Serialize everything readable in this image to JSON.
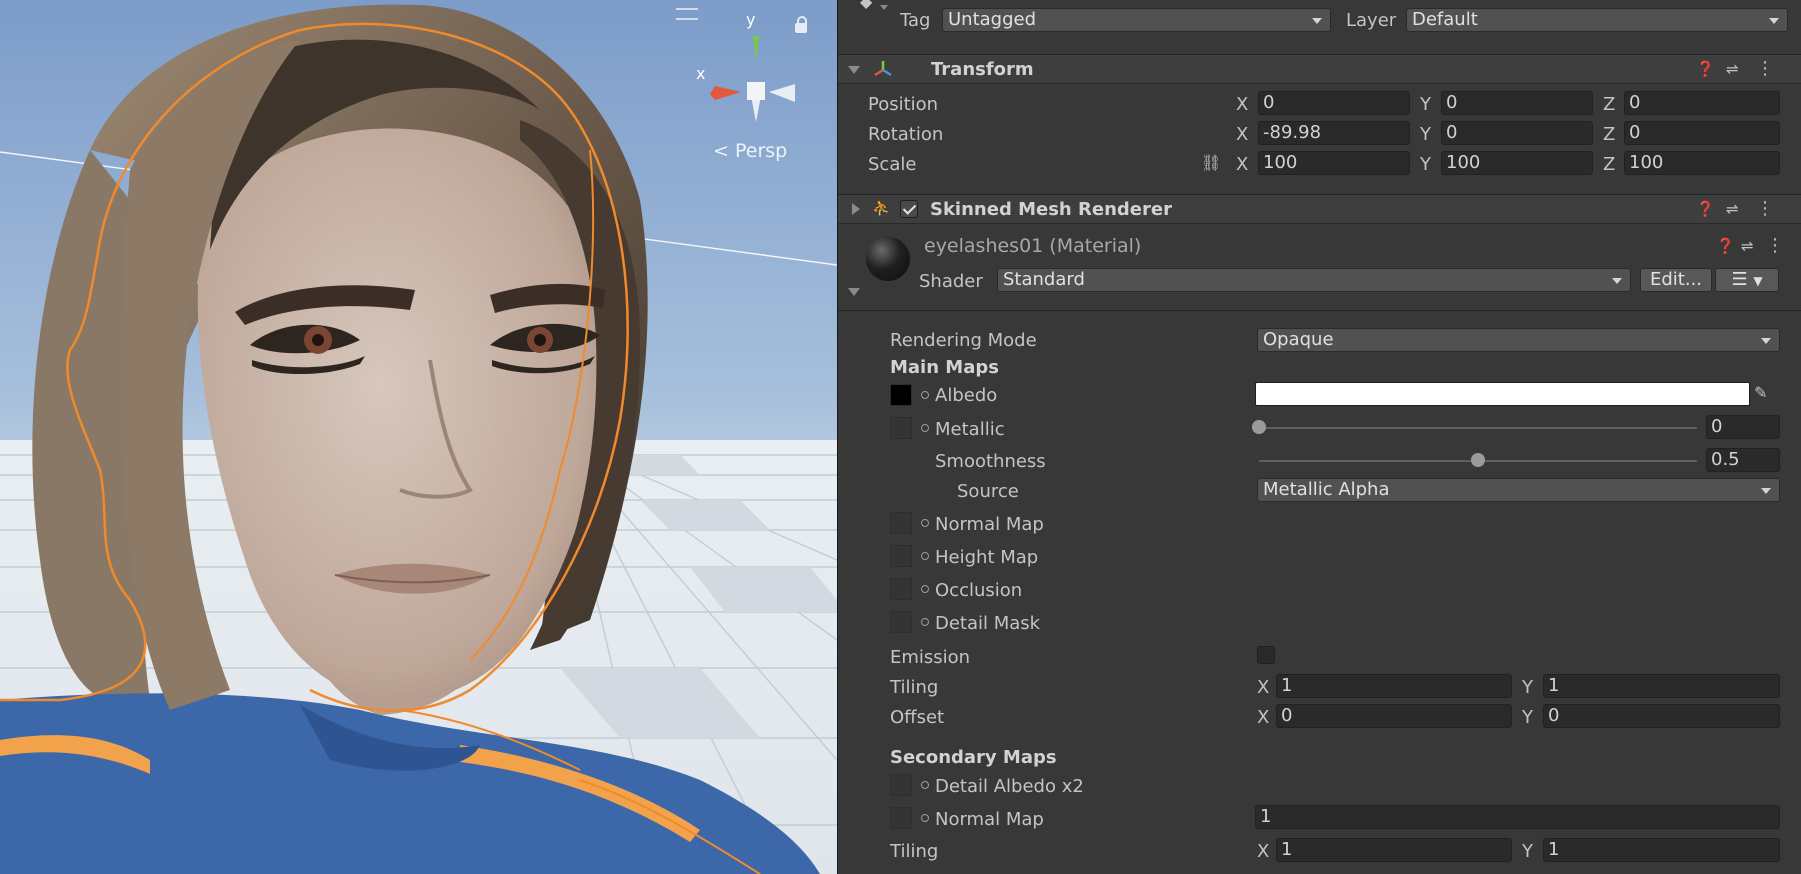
{
  "scene": {
    "gizmo_y_label": "y",
    "gizmo_x_label": "x",
    "projection_label": "Persp"
  },
  "inspector": {
    "tag_label": "Tag",
    "tag_value": "Untagged",
    "layer_label": "Layer",
    "layer_value": "Default",
    "transform": {
      "title": "Transform",
      "rows": [
        {
          "label": "Position",
          "x": "0",
          "y": "0",
          "z": "0"
        },
        {
          "label": "Rotation",
          "x": "-89.98",
          "y": "0",
          "z": "0"
        },
        {
          "label": "Scale",
          "x": "100",
          "y": "100",
          "z": "100"
        }
      ],
      "axis_x": "X",
      "axis_y": "Y",
      "axis_z": "Z"
    },
    "skinned_mesh": {
      "title": "Skinned Mesh Renderer",
      "enabled": true
    },
    "material": {
      "name": "eyelashes01 (Material)",
      "shader_label": "Shader",
      "shader_value": "Standard",
      "edit_button": "Edit...",
      "rendering_mode_label": "Rendering Mode",
      "rendering_mode_value": "Opaque",
      "main_maps_label": "Main Maps",
      "albedo_label": "Albedo",
      "albedo_color": "#ffffff",
      "metallic_label": "Metallic",
      "metallic_value": "0",
      "metallic_fraction": 0,
      "smoothness_label": "Smoothness",
      "smoothness_value": "0.5",
      "smoothness_fraction": 0.5,
      "source_label": "Source",
      "source_value": "Metallic Alpha",
      "normal_map_label": "Normal Map",
      "height_map_label": "Height Map",
      "occlusion_label": "Occlusion",
      "detail_mask_label": "Detail Mask",
      "emission_label": "Emission",
      "emission_enabled": false,
      "tiling_label": "Tiling",
      "tiling_x": "1",
      "tiling_y": "1",
      "offset_label": "Offset",
      "offset_x": "0",
      "offset_y": "0",
      "axis_x": "X",
      "axis_y": "Y",
      "secondary_maps_label": "Secondary Maps",
      "detail_albedo_label": "Detail Albedo x2",
      "secondary_normal_label": "Normal Map",
      "secondary_normal_value": "1",
      "secondary_tiling_label": "Tiling",
      "secondary_tiling_x": "1",
      "secondary_tiling_y": "1"
    }
  }
}
